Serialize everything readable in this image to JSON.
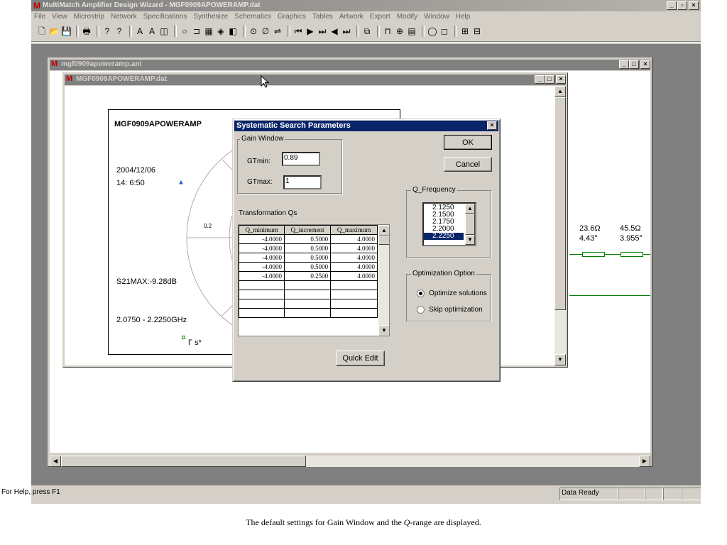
{
  "app": {
    "title": "MultiMatch Amplifier Design Wizard - MGF0909APOWERAMP.dat",
    "menu": [
      "File",
      "View",
      "Microstrip",
      "Network",
      "Specifications",
      "Synthesize",
      "Schematics",
      "Graphics",
      "Tables",
      "Artwork",
      "Export",
      "Modify",
      "Window",
      "Help"
    ],
    "toolbar_icons": [
      "new-icon",
      "open-icon",
      "save-icon",
      "print-icon",
      "help-icon",
      "context-help-icon",
      "tool-a-icon",
      "tool-b-icon",
      "tool-c-icon",
      "circle-icon",
      "tool-d-icon",
      "grid-icon",
      "tool-e-icon",
      "tool-f-icon",
      "target-icon",
      "tool-g-icon",
      "tool-h-icon",
      "first-icon",
      "play-icon",
      "step-icon",
      "back-icon",
      "last-icon",
      "copy-icon",
      "tool-i-icon",
      "tool-j-icon",
      "tool-k-icon",
      "ring-icon",
      "square-icon",
      "tool-l-icon",
      "tool-m-icon"
    ]
  },
  "windows": {
    "ani_title": "mgf0909apoweramp.ani",
    "dat_title": "MGF0909APOWERAMP.dat"
  },
  "smith": {
    "title": "MGF0909APOWERAMP",
    "date": "2004/12/06",
    "time": "14: 6:50",
    "s21": "S21MAX:-9.28dB",
    "freq_range": "2.0750 - 2.2250GHz",
    "legend": "Γ s*",
    "tick_label": "0.2"
  },
  "schematic": {
    "r1": "23.6Ω",
    "a1": "4.43°",
    "r2": "45.5Ω",
    "a2": "3.955°"
  },
  "dialog": {
    "title": "Systematic Search Parameters",
    "gain_window_label": "Gain Window",
    "gtmin_label": "GTmin:",
    "gtmin_value": "0.89",
    "gtmax_label": "GTmax:",
    "gtmax_value": "1",
    "transformation_label": "Transformation Qs",
    "table_headers": [
      "Q_minimum",
      "Q_increment",
      "Q_maximum"
    ],
    "table_rows": [
      [
        "-4.0000",
        "0.5000",
        "4.0000"
      ],
      [
        "-4.0000",
        "0.5000",
        "4.0000"
      ],
      [
        "-4.0000",
        "0.5000",
        "4.0000"
      ],
      [
        "-4.0000",
        "0.5000",
        "4.0000"
      ],
      [
        "-4.0000",
        "0.2500",
        "4.0000"
      ],
      [
        "",
        "",
        ""
      ],
      [
        "",
        "",
        ""
      ],
      [
        "",
        "",
        ""
      ],
      [
        "",
        "",
        ""
      ]
    ],
    "ok_label": "OK",
    "cancel_label": "Cancel",
    "qfreq_label": "Q_Frequency",
    "qfreq_items": [
      "2.1250",
      "2.1500",
      "2.1750",
      "2.2000",
      "2.2250"
    ],
    "qfreq_selected": "2.2250",
    "opt_label": "Optimization Option",
    "opt_solutions": "Optimize solutions",
    "opt_skip": "Skip optimization",
    "quick_edit_label": "Quick Edit"
  },
  "status": {
    "help": "For Help, press F1",
    "ready": "Data Ready"
  },
  "caption": {
    "before": "The default settings for Gain Window and the ",
    "q": "Q",
    "after": "-range are displayed."
  },
  "colors": {
    "title_active": "#0a246a",
    "face": "#d4d0c8",
    "mdi_bg": "#808080",
    "trace_green": "#008000",
    "marker_blue": "#2060c0"
  }
}
